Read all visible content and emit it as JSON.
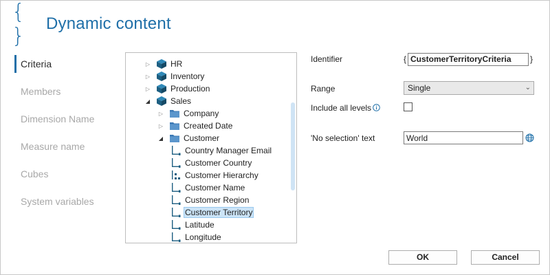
{
  "header": {
    "title": "Dynamic content",
    "icon": "braces-icon",
    "accent": "#1f6fa8"
  },
  "nav": {
    "items": [
      {
        "label": "Criteria",
        "active": true
      },
      {
        "label": "Members",
        "active": false
      },
      {
        "label": "Dimension Name",
        "active": false
      },
      {
        "label": "Measure name",
        "active": false
      },
      {
        "label": "Cubes",
        "active": false
      },
      {
        "label": "System variables",
        "active": false
      }
    ]
  },
  "tree": {
    "nodes": [
      {
        "label": "HR",
        "icon": "cube-icon",
        "expander": "collapsed"
      },
      {
        "label": "Inventory",
        "icon": "cube-icon",
        "expander": "collapsed"
      },
      {
        "label": "Production",
        "icon": "cube-icon",
        "expander": "collapsed"
      },
      {
        "label": "Sales",
        "icon": "cube-icon",
        "expander": "expanded"
      },
      {
        "label": "Company",
        "icon": "folder-icon",
        "expander": "collapsed"
      },
      {
        "label": "Created Date",
        "icon": "folder-icon",
        "expander": "collapsed"
      },
      {
        "label": "Customer",
        "icon": "folder-icon",
        "expander": "expanded"
      },
      {
        "label": "Country Manager Email",
        "icon": "attribute-icon",
        "expander": "none"
      },
      {
        "label": "Customer Country",
        "icon": "attribute-icon",
        "expander": "none"
      },
      {
        "label": "Customer Hierarchy",
        "icon": "hierarchy-icon",
        "expander": "none"
      },
      {
        "label": "Customer Name",
        "icon": "attribute-icon",
        "expander": "none"
      },
      {
        "label": "Customer Region",
        "icon": "attribute-icon",
        "expander": "none"
      },
      {
        "label": "Customer Territory",
        "icon": "attribute-icon",
        "expander": "none",
        "selected": true
      },
      {
        "label": "Latitude",
        "icon": "attribute-icon",
        "expander": "none"
      },
      {
        "label": "Longitude",
        "icon": "attribute-icon",
        "expander": "none"
      }
    ]
  },
  "form": {
    "identifier_label": "Identifier",
    "brace_open": "{",
    "brace_close": "}",
    "identifier_value": "CustomerTerritoryCriteria",
    "range_label": "Range",
    "range_value": "Single",
    "include_all_label": "Include all levels",
    "include_all_checked": false,
    "no_selection_label": "'No selection' text",
    "no_selection_value": "World"
  },
  "buttons": {
    "ok": "OK",
    "cancel": "Cancel"
  }
}
